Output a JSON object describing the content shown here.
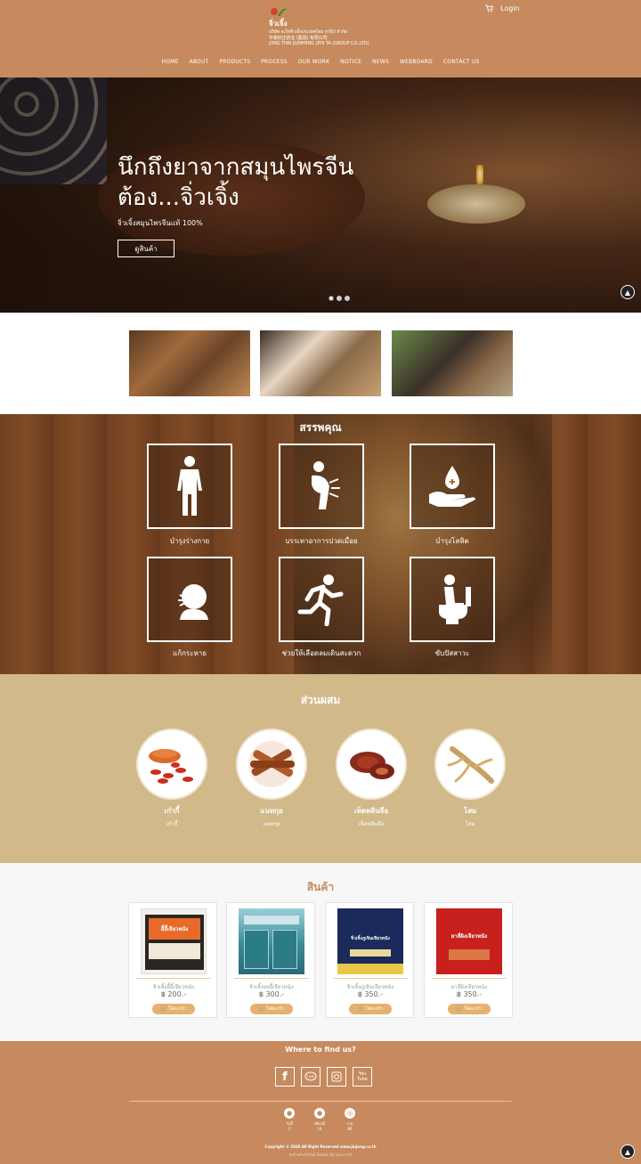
{
  "header": {
    "brand_name": "จิ่วเจิ้ง",
    "company_th": "บริษัท จงไท่จิ่วเจิ้งประเทศไทย (กรุ๊ป) จำกัด",
    "company_cn": "中泰旧正药业 (集团) 有限公司",
    "company_en": "JONG THAI JIUNHENG (PHI TA (GROUP CO.,LTD)",
    "login_label": "Login",
    "nav": [
      "HOME",
      "ABOUT",
      "PRODUCTS",
      "PROCESS",
      "OUR WORK",
      "NOTICE",
      "NEWS",
      "WEBBOARD",
      "CONTACT US"
    ]
  },
  "hero": {
    "title_line1": "นึกถึงยาจากสมุนไพรจีน",
    "title_line2": "ต้อง...จิ่วเจิ้ง",
    "subtitle": "จิ่วเจิ้งสมุนไพรจีนแท้ 100%",
    "button_label": "ดูสินค้า",
    "slide_count": 3,
    "active_slide": 1
  },
  "benefits": {
    "title": "สรรพคุณ",
    "items": [
      {
        "label": "บำรุงร่างกาย",
        "icon": "body-icon"
      },
      {
        "label": "บรรเทาอาการปวดเมื่อย",
        "icon": "back-pain-icon"
      },
      {
        "label": "บำรุงโลหิต",
        "icon": "blood-drop-hand-icon"
      },
      {
        "label": "แก้กระหาย",
        "icon": "thirst-icon"
      },
      {
        "label": "ช่วยให้เลือดลมเดินสะดวก",
        "icon": "running-icon"
      },
      {
        "label": "ขับปัสสาวะ",
        "icon": "toilet-icon"
      }
    ]
  },
  "ingredients": {
    "title": "ส่วนผสม",
    "items": [
      {
        "name": "เก๋ากี้",
        "desc": "เก๋ากี้"
      },
      {
        "name": "แนทกุย",
        "desc": "แนทกุย"
      },
      {
        "name": "เห็ดหลินจือ",
        "desc": "เห็ดหลินจือ"
      },
      {
        "name": "โสม",
        "desc": "โสม"
      }
    ]
  },
  "products": {
    "title": "สินค้า",
    "buy_label": "ใส่ตะกร้า",
    "items": [
      {
        "name": "จิ่วเจิ้งอี้อี้เจียวหนัง",
        "price": "฿ 200.-",
        "box_text": "อี้อี้เจียวหนัง"
      },
      {
        "name": "จิ่วเจิ้งหงอี้เจียวหนัง",
        "price": "฿ 300.-",
        "box_text": ""
      },
      {
        "name": "จิ่วเจิ้งภูเจินเจียวหนัง",
        "price": "฿ 350.-",
        "box_text": "จิ่วเจิ้งภูเจินเจียวหนัง"
      },
      {
        "name": "ยาลี่ผิงเจียวหนัง",
        "price": "฿ 350.-",
        "box_text": "ยาลี่ผิงเจียวหนัง"
      }
    ]
  },
  "footer": {
    "title": "Where to find us?",
    "socials": [
      "facebook-icon",
      "line-icon",
      "instagram-icon",
      "youtube-icon"
    ],
    "stats": [
      {
        "label": "วันนี้",
        "value": "2"
      },
      {
        "label": "เดือนนี้",
        "value": "14"
      },
      {
        "label": "รวม",
        "value": "86"
      }
    ],
    "copyright": "Copyright © 2020 All Right Reserved www.jiujeng.co.th",
    "credit": "รับจ้างทำเว็บไซต์ Design By xxx.co.th"
  },
  "colors": {
    "header": "#c68a5e",
    "ingredients_bg": "#d1b98a",
    "products_title": "#c68a5e",
    "buy_button": "#e6b06e"
  }
}
